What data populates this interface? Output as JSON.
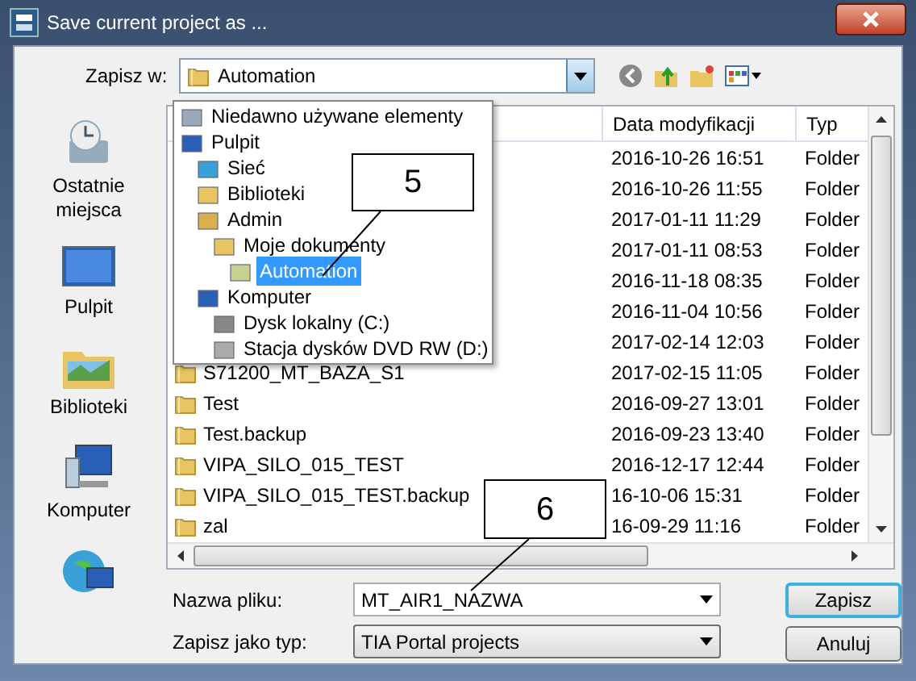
{
  "window": {
    "title": "Save current project as ..."
  },
  "toolbar": {
    "save_in_label": "Zapisz w:",
    "save_in_value": "Automation"
  },
  "places": [
    {
      "label": "Ostatnie miejsca"
    },
    {
      "label": "Pulpit"
    },
    {
      "label": "Biblioteki"
    },
    {
      "label": "Komputer"
    }
  ],
  "location_dropdown": {
    "items": [
      {
        "label": "Niedawno używane elementy",
        "selected": false
      },
      {
        "label": "Pulpit",
        "selected": false,
        "children": [
          {
            "label": "Sieć",
            "selected": false
          },
          {
            "label": "Biblioteki",
            "selected": false
          },
          {
            "label": "Admin",
            "selected": false,
            "children": [
              {
                "label": "Moje dokumenty",
                "selected": false,
                "children": [
                  {
                    "label": "Automation",
                    "selected": true
                  }
                ]
              }
            ]
          },
          {
            "label": "Komputer",
            "selected": false,
            "children": [
              {
                "label": "Dysk lokalny (C:)",
                "selected": false
              },
              {
                "label": "Stacja dysków DVD RW (D:)",
                "selected": false
              }
            ]
          }
        ]
      }
    ]
  },
  "file_list": {
    "columns": [
      "Data modyfikacji",
      "Typ"
    ],
    "rows": [
      {
        "date": "2016-10-26 16:51",
        "type": "Folder"
      },
      {
        "date": "2016-10-26 11:55",
        "type": "Folder"
      },
      {
        "date": "2017-01-11 11:29",
        "type": "Folder"
      },
      {
        "date": "2017-01-11 08:53",
        "type": "Folder"
      },
      {
        "date": "2016-11-18 08:35",
        "type": "Folder"
      },
      {
        "date": "2016-11-04 10:56",
        "type": "Folder"
      },
      {
        "date": "2017-02-14 12:03",
        "type": "Folder"
      },
      {
        "name": "S71200_MT_BAZA_S1",
        "date": "2017-02-15 11:05",
        "type": "Folder"
      },
      {
        "name": "Test",
        "date": "2016-09-27 13:01",
        "type": "Folder"
      },
      {
        "name": "Test.backup",
        "date": "2016-09-23 13:40",
        "type": "Folder"
      },
      {
        "name": "VIPA_SILO_015_TEST",
        "date": "2016-12-17 12:44",
        "type": "Folder"
      },
      {
        "name": "VIPA_SILO_015_TEST.backup",
        "date": "16-10-06 15:31",
        "type": "Folder"
      },
      {
        "name": "zal",
        "date": "16-09-29 11:16",
        "type": "Folder"
      }
    ]
  },
  "file_name": {
    "label": "Nazwa pliku:",
    "value": "MT_AIR1_NAZWA"
  },
  "file_type": {
    "label": "Zapisz jako typ:",
    "value": "TIA Portal projects"
  },
  "buttons": [
    {
      "label": "Zapisz",
      "default": true
    },
    {
      "label": "Anuluj",
      "default": false
    }
  ],
  "callouts": [
    {
      "label": "5"
    },
    {
      "label": "6"
    }
  ]
}
